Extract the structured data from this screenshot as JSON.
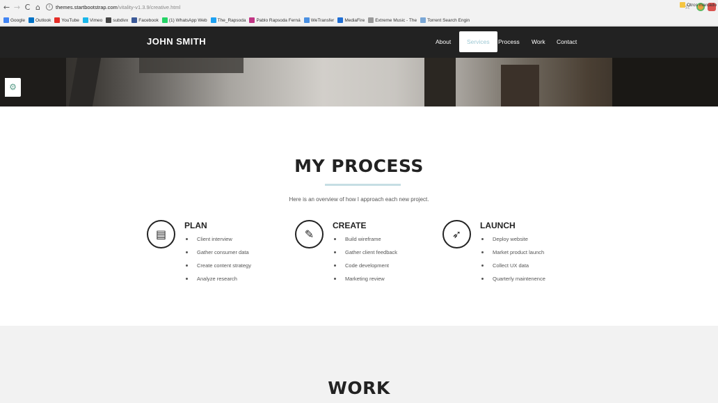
{
  "browser": {
    "nav": {
      "back": "←",
      "forward": "→",
      "reload": "C",
      "home": "⌂"
    },
    "url_host": "themes.startbootstrap.com",
    "url_path": "/vitality-v1.3.9/creative.html",
    "bookmarks": [
      {
        "label": "Google",
        "color": "#4285f4",
        "icon": "google-icon"
      },
      {
        "label": "Outlook",
        "color": "#0072c6",
        "icon": "outlook-icon"
      },
      {
        "label": "YouTube",
        "color": "#e52d27",
        "icon": "youtube-icon"
      },
      {
        "label": "Vimeo",
        "color": "#1ab7ea",
        "icon": "vimeo-icon"
      },
      {
        "label": "subdivx",
        "color": "#444444",
        "icon": "subdivx-icon"
      },
      {
        "label": "Facebook",
        "color": "#3b5998",
        "icon": "facebook-icon"
      },
      {
        "label": "(1) WhatsApp Web",
        "color": "#25d366",
        "icon": "whatsapp-icon"
      },
      {
        "label": "The_Rapsoda",
        "color": "#1da1f2",
        "icon": "twitter-icon"
      },
      {
        "label": "Pablo Rapsoda Ferná",
        "color": "#c13584",
        "icon": "instagram-icon"
      },
      {
        "label": "WeTransfer",
        "color": "#4a90e2",
        "icon": "wetransfer-icon"
      },
      {
        "label": "MediaFire",
        "color": "#1f6ed4",
        "icon": "mediafire-icon"
      },
      {
        "label": "Extreme Music - The",
        "color": "#999999",
        "icon": "page-icon"
      },
      {
        "label": "Torrent Search Engin",
        "color": "#7aa7d6",
        "icon": "torrent-icon"
      }
    ],
    "other_bookmarks": "Otros marcado",
    "other_color": "#f5c542"
  },
  "site": {
    "brand": "JOHN SMITH",
    "menu": [
      "About",
      "Services",
      "Process",
      "Work",
      "Contact"
    ],
    "active_menu": "Services",
    "accent": "#9ec9d4"
  },
  "process": {
    "title": "MY PROCESS",
    "subtitle": "Here is an overview of how I approach each new project.",
    "columns": [
      {
        "title": "PLAN",
        "icon": "clipboard-icon",
        "glyph": "▤",
        "items": [
          "Client interview",
          "Gather consumer data",
          "Create content strategy",
          "Analyze research"
        ]
      },
      {
        "title": "CREATE",
        "icon": "pencil-icon",
        "glyph": "✎",
        "items": [
          "Build wireframe",
          "Gather client feedback",
          "Code development",
          "Marketing review"
        ]
      },
      {
        "title": "LAUNCH",
        "icon": "rocket-icon",
        "glyph": "➶",
        "items": [
          "Deploy website",
          "Market product launch",
          "Collect UX data",
          "Quarterly maintenence"
        ]
      }
    ]
  },
  "work": {
    "title": "WORK"
  },
  "settings_icon": "gear-icon"
}
